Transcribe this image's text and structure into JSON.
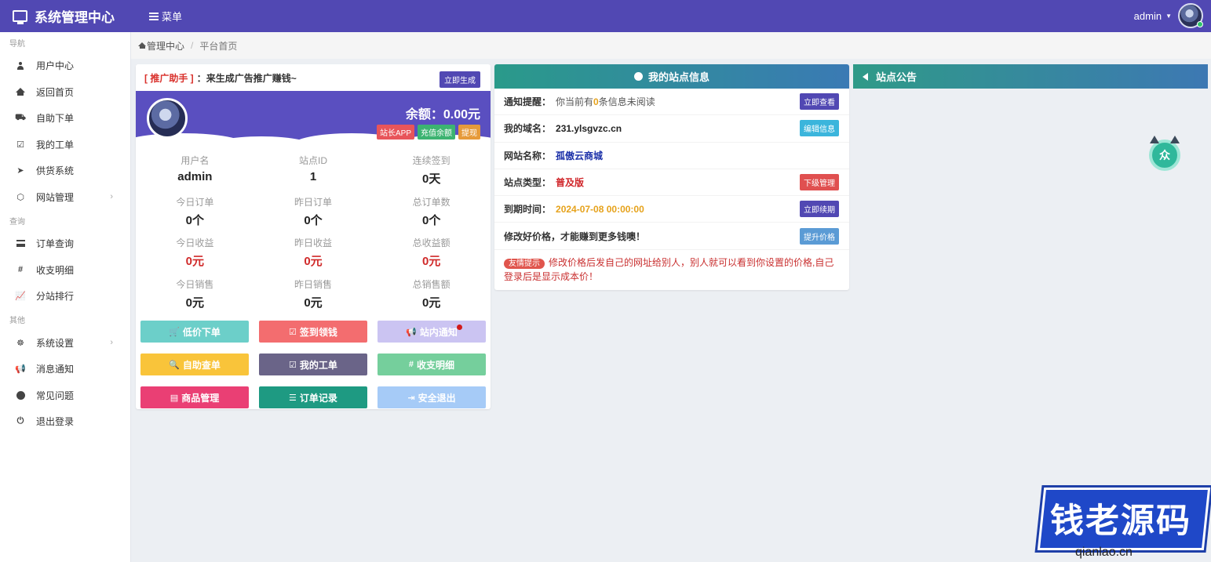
{
  "header": {
    "title": "系统管理中心",
    "menu_label": "菜单",
    "username": "admin"
  },
  "sidebar": {
    "sections": [
      {
        "title": "导航",
        "items": [
          {
            "label": "用户中心",
            "icon": "user-icon"
          },
          {
            "label": "返回首页",
            "icon": "home-icon"
          },
          {
            "label": "自助下单",
            "icon": "cart-icon"
          },
          {
            "label": "我的工单",
            "icon": "check-square-icon"
          },
          {
            "label": "供货系统",
            "icon": "rocket-icon"
          },
          {
            "label": "网站管理",
            "icon": "cube-icon",
            "has_arrow": true
          }
        ]
      },
      {
        "title": "查询",
        "items": [
          {
            "label": "订单查询",
            "icon": "list-icon"
          },
          {
            "label": "收支明细",
            "icon": "hash-icon"
          },
          {
            "label": "分站排行",
            "icon": "line-chart-icon"
          }
        ]
      },
      {
        "title": "其他",
        "items": [
          {
            "label": "系统设置",
            "icon": "settings-icon",
            "has_arrow": true
          },
          {
            "label": "消息通知",
            "icon": "bullhorn-icon"
          },
          {
            "label": "常见问题",
            "icon": "exclamation-icon"
          },
          {
            "label": "退出登录",
            "icon": "power-icon"
          }
        ]
      }
    ]
  },
  "breadcrumb": {
    "home": "管理中心",
    "current": "平台首页"
  },
  "promo": {
    "tag": "[ 推广助手 ]",
    "colon": "：",
    "text": "来生成广告推广赚钱~",
    "button": "立即生成"
  },
  "profile": {
    "balance": "余额：0.00元",
    "buttons": [
      {
        "label": "站长APP",
        "color": "#e8555a"
      },
      {
        "label": "充值余额",
        "color": "#3cb371"
      },
      {
        "label": "提现",
        "color": "#e69a3a"
      }
    ]
  },
  "stats": [
    {
      "label": "用户名",
      "value": "admin",
      "red": false
    },
    {
      "label": "站点ID",
      "value": "1",
      "red": false
    },
    {
      "label": "连续签到",
      "value": "0天",
      "red": false
    },
    {
      "label": "今日订单",
      "value": "0个",
      "red": false
    },
    {
      "label": "昨日订单",
      "value": "0个",
      "red": false
    },
    {
      "label": "总订单数",
      "value": "0个",
      "red": false
    },
    {
      "label": "今日收益",
      "value": "0元",
      "red": true
    },
    {
      "label": "昨日收益",
      "value": "0元",
      "red": true
    },
    {
      "label": "总收益额",
      "value": "0元",
      "red": true
    },
    {
      "label": "今日销售",
      "value": "0元",
      "red": false
    },
    {
      "label": "昨日销售",
      "value": "0元",
      "red": false
    },
    {
      "label": "总销售额",
      "value": "0元",
      "red": false
    }
  ],
  "quick_buttons": [
    {
      "label": "低价下单",
      "icon": "cart-icon",
      "glyph": "🛒",
      "color": "#6ccfc9"
    },
    {
      "label": "签到领钱",
      "icon": "check-icon",
      "glyph": "☑",
      "color": "#f36d6f"
    },
    {
      "label": "站内通知",
      "icon": "bullhorn-icon",
      "glyph": "📢",
      "color": "#cbc4f2",
      "dot": true
    },
    {
      "label": "自助查单",
      "icon": "search-icon",
      "glyph": "🔍",
      "color": "#f9c43a"
    },
    {
      "label": "我的工单",
      "icon": "check-square-icon",
      "glyph": "☑",
      "color": "#6a6488"
    },
    {
      "label": "收支明细",
      "icon": "hash-icon",
      "glyph": "#",
      "color": "#75cf9c"
    },
    {
      "label": "商品管理",
      "icon": "list-alt-icon",
      "glyph": "▤",
      "color": "#ea3f74"
    },
    {
      "label": "订单记录",
      "icon": "list-icon",
      "glyph": "☰",
      "color": "#1e9a82"
    },
    {
      "label": "安全退出",
      "icon": "sign-out-icon",
      "glyph": "⇥",
      "color": "#a6cbf7"
    }
  ],
  "site_info": {
    "title": "我的站点信息",
    "notice": {
      "key": "通知提醒：",
      "pre": "你当前有",
      "count": "0",
      "post": "条信息未阅读",
      "button": "立即查看",
      "button_color": "#5148b3"
    },
    "domain": {
      "key": "我的域名：",
      "value": "231.ylsgvzc.cn",
      "button": "编辑信息",
      "button_color": "#3bb5dc"
    },
    "name": {
      "key": "网站名称：",
      "value": "孤傲云商城"
    },
    "type": {
      "key": "站点类型：",
      "value": "普及版",
      "button": "下级管理",
      "button_color": "#e05050"
    },
    "expire": {
      "key": "到期时间：",
      "value": "2024-07-08 00:00:00",
      "button": "立即续期",
      "button_color": "#5148b3"
    },
    "price": {
      "key": "修改好价格，才能赚到更多钱噢！",
      "button": "提升价格",
      "button_color": "#5b9bd5"
    },
    "tip": {
      "badge": "友情提示",
      "text": "修改价格后发自己的网址给别人，别人就可以看到你设置的价格,自己登录后是显示成本价！"
    }
  },
  "announcement": {
    "title": "站点公告"
  },
  "widget": {
    "bot_label": "众"
  },
  "watermark": {
    "text": "钱老源码",
    "sub": "qianlao.cn"
  }
}
